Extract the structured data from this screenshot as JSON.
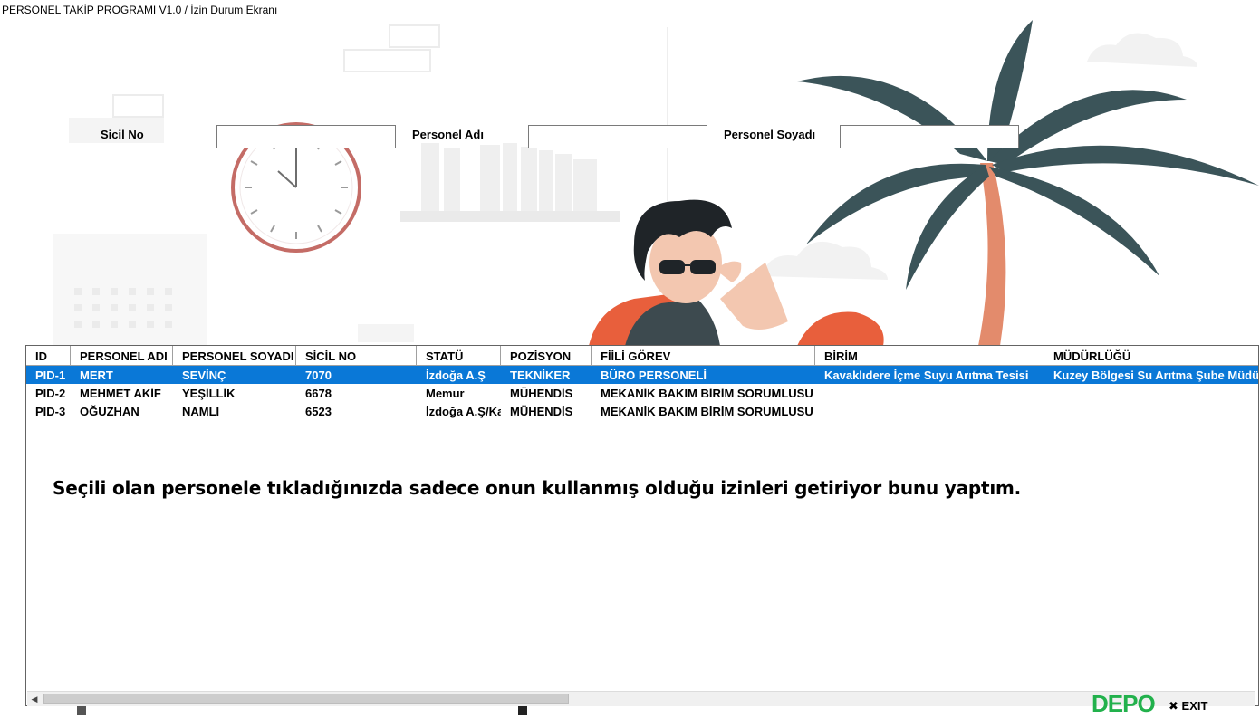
{
  "window": {
    "title": "PERSONEL TAKİP PROGRAMI V1.0 / İzin Durum Ekranı"
  },
  "filters": {
    "sicil_label": "Sicil No",
    "ad_label": "Personel Adı",
    "soyad_label": "Personel Soyadı",
    "sicil_value": "",
    "ad_value": "",
    "soyad_value": ""
  },
  "grid": {
    "columns": [
      "ID",
      "PERSONEL ADI",
      "PERSONEL SOYADI",
      "SİCİL NO",
      "STATÜ",
      "POZİSYON",
      "FİİLİ GÖREV",
      "BİRİM",
      "MÜDÜRLÜĞÜ"
    ],
    "rows": [
      [
        "PID-1",
        "MERT",
        "SEVİNÇ",
        "7070",
        "İzdoğa A.Ş",
        "TEKNİKER",
        "BÜRO PERSONELİ",
        "Kavaklıdere İçme Suyu Arıtma Tesisi",
        "Kuzey Bölgesi Su Arıtma Şube Müdü"
      ],
      [
        "PID-2",
        "MEHMET AKİF",
        "YEŞİLLİK",
        "6678",
        "Memur",
        "MÜHENDİS",
        "MEKANİK BAKIM BİRİM SORUMLUSU",
        "",
        ""
      ],
      [
        "PID-3",
        "OĞUZHAN",
        "NAMLI",
        "6523",
        "İzdoğa A.Ş/Ka",
        "MÜHENDİS",
        "MEKANİK BAKIM BİRİM SORUMLUSU",
        "",
        ""
      ]
    ],
    "selected_row": 0
  },
  "note": "Seçili olan personele tıkladığınızda sadece onun kullanmış olduğu izinleri getiriyor bunu yaptım.",
  "footer": {
    "exit_label": "EXIT",
    "watermark": "DEPO"
  },
  "colors": {
    "selection": "#0a78d7",
    "palm": "#3b5459",
    "trunk": "#e38b6c",
    "shirt": "#e85f3c"
  },
  "icons": [
    "clock-illustration",
    "palm-tree-illustration",
    "person-illustration",
    "close-icon",
    "scroll-left-arrow-icon"
  ]
}
